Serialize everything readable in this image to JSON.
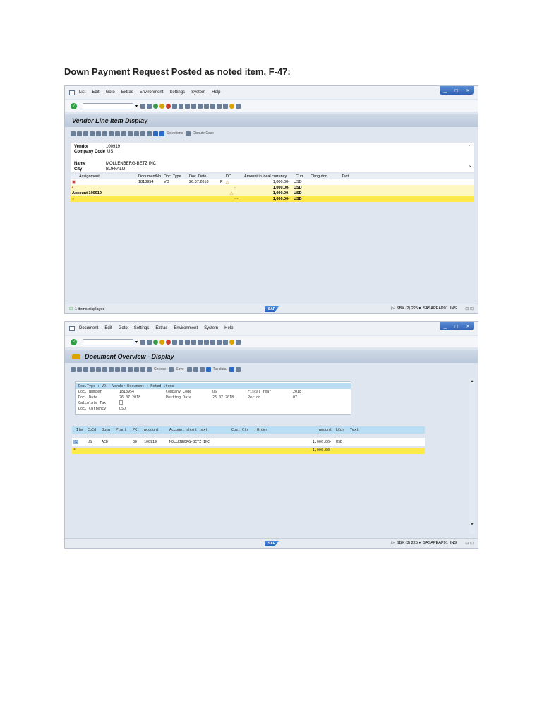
{
  "heading": "Down Payment Request Posted as noted item, F-47:",
  "w1": {
    "menu": [
      "List",
      "Edit",
      "Goto",
      "Extras",
      "Environment",
      "Settings",
      "System",
      "Help"
    ],
    "title": "Vendor Line Item Display",
    "apptb_selections": "Selections",
    "apptb_dispute": "Dispute Case",
    "header": {
      "vendor_label": "Vendor",
      "vendor_value": "100919",
      "company_label": "Company Code",
      "company_value": "US",
      "name_label": "Name",
      "name_value": "MOLLENBERG-BETZ INC",
      "city_label": "City",
      "city_value": "BUFFALO"
    },
    "columns": [
      "Assignment",
      "DocumentNo",
      "Doc. Type",
      "Doc. Date",
      "DD",
      "Amount in local currency",
      "LCurr",
      "Clrng doc.",
      "Text"
    ],
    "row1": {
      "docno": "1818954",
      "type": "VD",
      "date": "26.07.2018",
      "flag": "F",
      "amount": "1,000.00-",
      "curr": "USD"
    },
    "row2": {
      "amount": "1,000.00-",
      "curr": "USD"
    },
    "row3": {
      "label": "Account 100919",
      "amount": "1,000.00-",
      "curr": "USD"
    },
    "row4": {
      "amount": "1,000.00-",
      "curr": "USD"
    },
    "status": "1 items displayed",
    "sysinfo": "SBX (2) 225",
    "server": "SASAPEAP01",
    "mode": "INS"
  },
  "w2": {
    "menu": [
      "Document",
      "Edit",
      "Goto",
      "Settings",
      "Extras",
      "Environment",
      "System",
      "Help"
    ],
    "title": "Document Overview - Display",
    "apptb_choose": "Choose",
    "apptb_save": "Save",
    "apptb_tax": "Tax data",
    "info": {
      "line1": "Doc.Type : VD ( Vendor Document ) Noted items",
      "docnum_label": "Doc. Number",
      "docnum": "1818954",
      "cc_label": "Company Code",
      "cc": "US",
      "fy_label": "Fiscal Year",
      "fy": "2018",
      "docdate_label": "Doc. Date",
      "docdate": "26.07.2018",
      "postdate_label": "Posting Date",
      "postdate": "26.07.2018",
      "period_label": "Period",
      "period": "07",
      "calc_label": "Calculate Tax",
      "curr_label": "Doc. Currency",
      "curr": "USD"
    },
    "columns": [
      "Itm",
      "CoCd",
      "BusA",
      "Plant",
      "PK",
      "Account",
      "Account short text",
      "Cost Ctr",
      "Order",
      "Amount",
      "LCur",
      "Text"
    ],
    "row1": {
      "itm": "1",
      "cocd": "US",
      "busa": "ACD",
      "pk": "39",
      "account": "100919",
      "text": "MOLLENBERG-BETZ INC",
      "amount": "1,000.00-",
      "lcur": "USD"
    },
    "row2": {
      "itm": "*",
      "amount": "1,000.00-"
    },
    "sysinfo": "SBX (3) 225",
    "server": "SASAPEAP01",
    "mode": "INS"
  }
}
